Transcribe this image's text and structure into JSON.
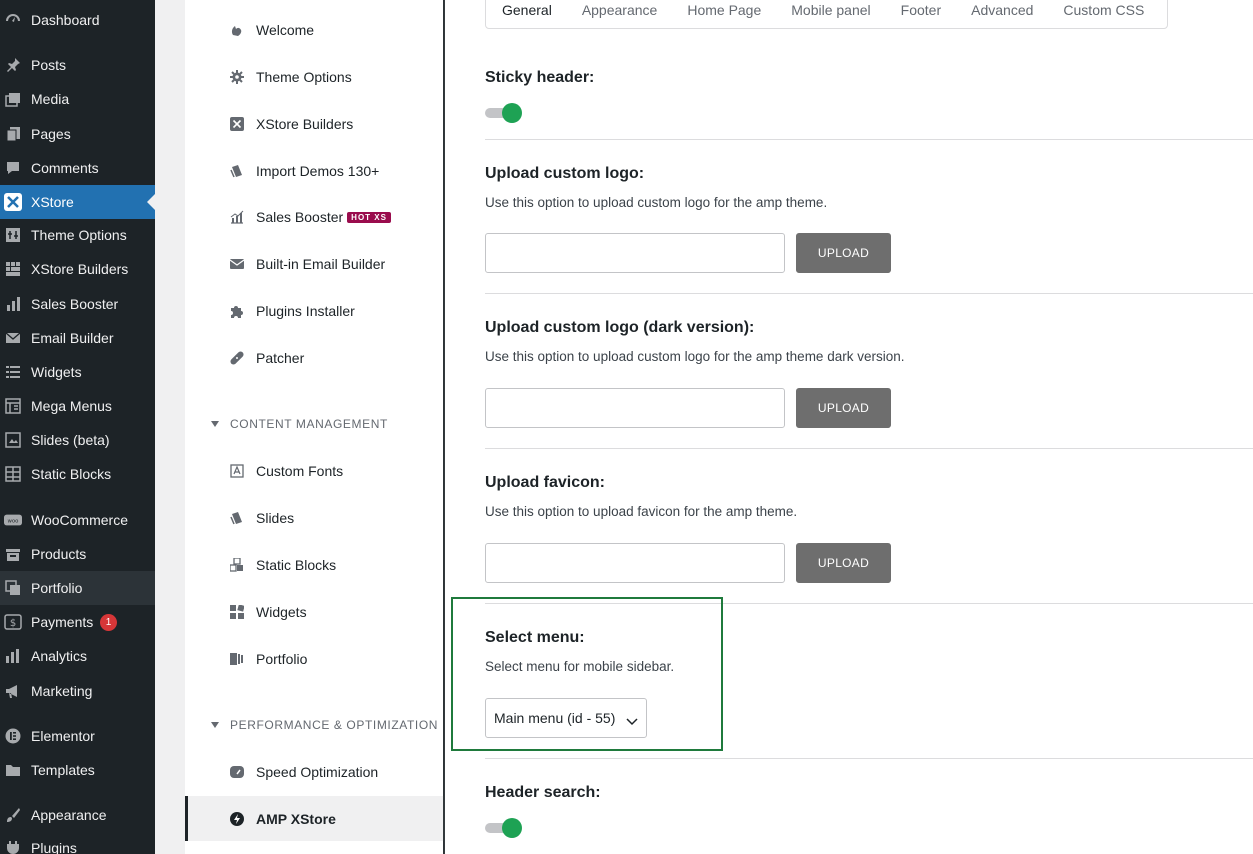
{
  "wp_menu": [
    {
      "label": "Dashboard",
      "icon": "dashboard-icon"
    },
    {
      "label": "Posts",
      "icon": "pin-icon"
    },
    {
      "label": "Media",
      "icon": "media-icon"
    },
    {
      "label": "Pages",
      "icon": "pages-icon"
    },
    {
      "label": "Comments",
      "icon": "comment-icon"
    },
    {
      "label": "XStore",
      "icon": "xstore-icon",
      "active": true
    },
    {
      "label": "Theme Options",
      "icon": "theme-options-icon"
    },
    {
      "label": "XStore Builders",
      "icon": "builders-icon"
    },
    {
      "label": "Sales Booster",
      "icon": "bar-chart-icon"
    },
    {
      "label": "Email Builder",
      "icon": "email-icon"
    },
    {
      "label": "Widgets",
      "icon": "widgets-icon"
    },
    {
      "label": "Mega Menus",
      "icon": "mega-menu-icon"
    },
    {
      "label": "Slides (beta)",
      "icon": "slides-icon"
    },
    {
      "label": "Static Blocks",
      "icon": "static-blocks-icon"
    },
    {
      "label": "WooCommerce",
      "icon": "woo-icon"
    },
    {
      "label": "Products",
      "icon": "products-icon"
    },
    {
      "label": "Portfolio",
      "icon": "portfolio-icon"
    },
    {
      "label": "Payments",
      "icon": "payments-icon",
      "badge": "1"
    },
    {
      "label": "Analytics",
      "icon": "analytics-icon"
    },
    {
      "label": "Marketing",
      "icon": "megaphone-icon"
    },
    {
      "label": "Elementor",
      "icon": "elementor-icon"
    },
    {
      "label": "Templates",
      "icon": "folder-icon"
    },
    {
      "label": "Appearance",
      "icon": "brush-icon"
    },
    {
      "label": "Plugins",
      "icon": "plugin-icon"
    }
  ],
  "xstore_menu": {
    "items": [
      {
        "label": "Welcome",
        "icon": "welcome-icon"
      },
      {
        "label": "Theme Options",
        "icon": "gear-icon"
      },
      {
        "label": "XStore Builders",
        "icon": "x-box-icon"
      },
      {
        "label": "Import Demos 130+",
        "icon": "import-icon"
      },
      {
        "label": "Sales Booster",
        "icon": "chart-icon",
        "badge": "HOT XS"
      },
      {
        "label": "Built-in Email Builder",
        "icon": "envelope-icon"
      },
      {
        "label": "Plugins Installer",
        "icon": "puzzle-icon"
      },
      {
        "label": "Patcher",
        "icon": "bandage-icon"
      }
    ],
    "section_content": "CONTENT MANAGEMENT",
    "content_items": [
      {
        "label": "Custom Fonts",
        "icon": "font-icon"
      },
      {
        "label": "Slides",
        "icon": "slides-icon"
      },
      {
        "label": "Static Blocks",
        "icon": "blocks-icon"
      },
      {
        "label": "Widgets",
        "icon": "widgets-icon"
      },
      {
        "label": "Portfolio",
        "icon": "portfolio-icon"
      }
    ],
    "section_perf": "PERFORMANCE & OPTIMIZATION",
    "perf_items": [
      {
        "label": "Speed Optimization",
        "icon": "speedometer-icon"
      },
      {
        "label": "AMP XStore",
        "icon": "bolt-icon",
        "active": true
      }
    ]
  },
  "tabs": [
    "General",
    "Appearance",
    "Home Page",
    "Mobile panel",
    "Footer",
    "Advanced",
    "Custom CSS"
  ],
  "settings": {
    "sticky_header": {
      "title": "Sticky header:",
      "enabled": true
    },
    "logo": {
      "title": "Upload custom logo:",
      "desc": "Use this option to upload custom logo for the amp theme.",
      "button": "UPLOAD"
    },
    "logo_dark": {
      "title": "Upload custom logo (dark version):",
      "desc": "Use this option to upload custom logo for the amp theme dark version.",
      "button": "UPLOAD"
    },
    "favicon": {
      "title": "Upload favicon:",
      "desc": "Use this option to upload favicon for the amp theme.",
      "button": "UPLOAD"
    },
    "menu": {
      "title": "Select menu:",
      "desc": "Select menu for mobile sidebar.",
      "value": "Main menu (id - 55)"
    },
    "header_search": {
      "title": "Header search:",
      "enabled": true
    }
  },
  "colors": {
    "accent": "#2271b1",
    "toggle_on": "#1ea254",
    "highlight": "#1f7a3c",
    "hot_badge": "#9a0c4d"
  }
}
